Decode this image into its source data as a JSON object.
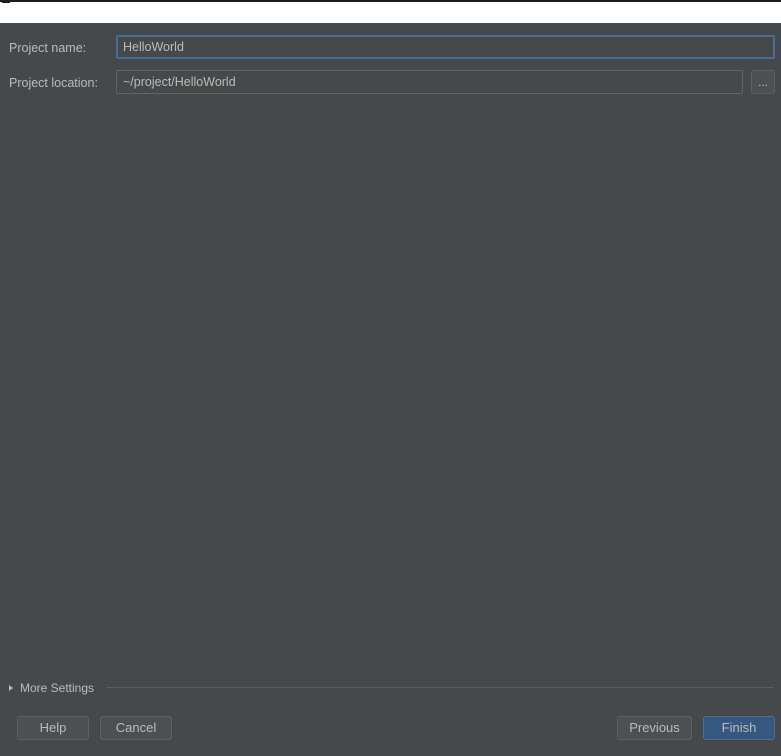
{
  "form": {
    "project_name_label": "Project name:",
    "project_name_value": "HelloWorld",
    "project_location_label": "Project location:",
    "project_location_value": "~/project/HelloWorld",
    "browse_label": "..."
  },
  "more_settings": {
    "label": "More Settings",
    "expanded": false
  },
  "footer": {
    "help_label": "Help",
    "cancel_label": "Cancel",
    "previous_label": "Previous",
    "finish_label": "Finish"
  },
  "colors": {
    "background": "#45494b",
    "focus_border": "#466d94",
    "primary_button": "#365880",
    "text": "#bbbbbb"
  }
}
